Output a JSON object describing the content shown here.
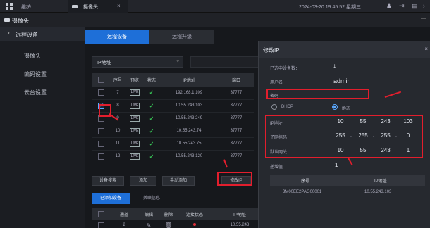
{
  "topbar": {
    "left_label": "维护",
    "tab_label": "摄像头",
    "tab_close": "×",
    "datetime": "2024-03-20 19:45:52 星期三"
  },
  "header": {
    "title": "摄像头"
  },
  "sidebar": {
    "items": [
      {
        "label": "远程设备",
        "chevron": "›"
      },
      {
        "label": "摄像头"
      },
      {
        "label": "编码设置"
      },
      {
        "label": "云台设置"
      }
    ]
  },
  "main": {
    "tabs": [
      {
        "label": "远程设备"
      },
      {
        "label": "远程升级"
      }
    ],
    "filter": {
      "label": "IP地址",
      "arrow": "▾"
    },
    "device_table": {
      "headers": [
        "",
        "序号",
        "预览",
        "状态",
        "IP地址",
        "端口"
      ],
      "rows": [
        {
          "no": "7",
          "preview": "LIVE",
          "status": "✓",
          "ip": "192.168.1.109",
          "port": "37777"
        },
        {
          "no": "8",
          "preview": "LIVE",
          "status": "✓",
          "ip": "10.55.243.103",
          "port": "37777"
        },
        {
          "no": "9",
          "preview": "LIVE",
          "status": "✓",
          "ip": "10.55.243.249",
          "port": "37777"
        },
        {
          "no": "10",
          "preview": "LIVE",
          "status": "✓",
          "ip": "10.55.243.74",
          "port": "37777"
        },
        {
          "no": "11",
          "preview": "LIVE",
          "status": "✓",
          "ip": "10.55.243.75",
          "port": "37777"
        },
        {
          "no": "12",
          "preview": "LIVE",
          "status": "✓",
          "ip": "10.55.243.120",
          "port": "37777"
        }
      ]
    },
    "buttons": {
      "search": "设备搜索",
      "add": "添加",
      "manual_add": "手动添加",
      "modify_ip": "修改IP"
    },
    "bottom_tabs": [
      {
        "label": "已添加设备"
      },
      {
        "label": "关联信息"
      }
    ],
    "added_table": {
      "headers": [
        "",
        "通道",
        "编辑",
        "删除",
        "连接状态",
        "IP地址"
      ],
      "row": {
        "channel": "2",
        "ip": "10.55.243"
      }
    }
  },
  "dialog": {
    "title": "修改IP",
    "close": "×",
    "selected_count_label": "已选中设备数：",
    "selected_count": "1",
    "username_label": "用户名",
    "username": "admin",
    "password_label": "密码",
    "dhcp_label": "DHCP",
    "static_label": "静态",
    "ip_label": "IP地址",
    "ip": [
      "10",
      "55",
      "243",
      "103"
    ],
    "mask_label": "子网掩码",
    "mask": [
      "255",
      "255",
      "255",
      "0"
    ],
    "gateway_label": "默认网关",
    "gateway": [
      "10",
      "55",
      "243",
      "1"
    ],
    "increment_label": "递增值",
    "increment": "1",
    "table": {
      "headers": [
        "序号",
        "IP地址"
      ],
      "row": {
        "serial": "3M00EE2PAG00001",
        "ip": "10.55.243.103"
      }
    }
  },
  "colors": {
    "accent": "#1e6fd8",
    "annotation_red": "#e21e2d",
    "status_green": "#37c456"
  }
}
